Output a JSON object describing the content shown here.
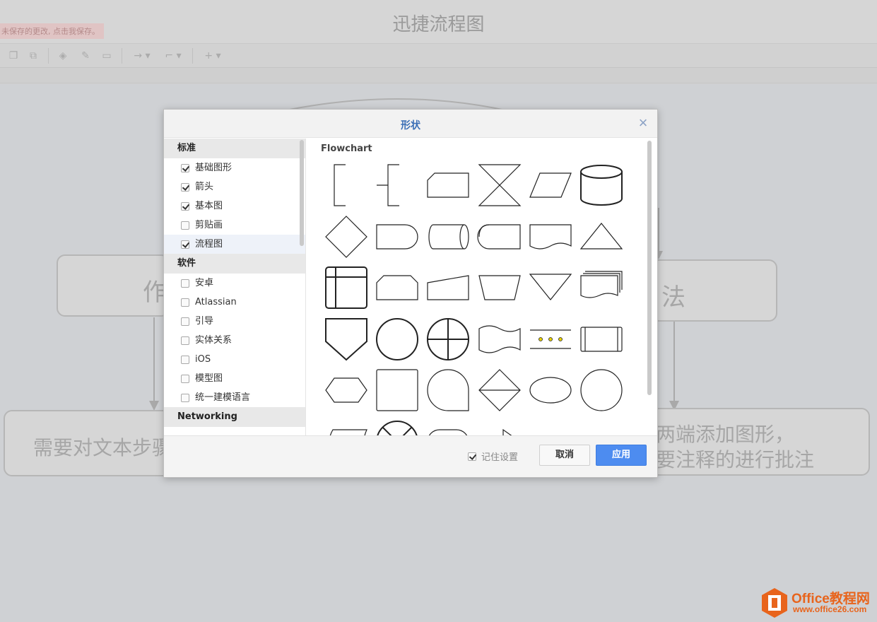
{
  "app": {
    "title": "迅捷流程图",
    "unsaved_notice": "未保存的更改, 点击我保存。"
  },
  "toolbar": {
    "icons": [
      "copy-icon",
      "duplicate-icon",
      "fill-color-icon",
      "line-color-icon",
      "shadow-icon",
      "connector-straight-icon",
      "connector-elbow-icon",
      "add-icon"
    ]
  },
  "canvas": {
    "box_left_text": "作",
    "box_right_text": "法",
    "bottom_left_text": "需要对文本步骤",
    "bottom_right_line1": "两端添加图形，",
    "bottom_right_line2": "要注释的进行批注"
  },
  "dialog": {
    "title": "形状",
    "close_icon": "close-icon",
    "sidebar": {
      "groups": [
        {
          "label": "标准",
          "items": [
            {
              "label": "基础图形",
              "checked": true
            },
            {
              "label": "箭头",
              "checked": true
            },
            {
              "label": "基本图",
              "checked": true
            },
            {
              "label": "剪贴画",
              "checked": false
            },
            {
              "label": "流程图",
              "checked": true
            }
          ]
        },
        {
          "label": "软件",
          "items": [
            {
              "label": "安卓",
              "checked": false
            },
            {
              "label": "Atlassian",
              "checked": false
            },
            {
              "label": "引导",
              "checked": false
            },
            {
              "label": "实体关系",
              "checked": false
            },
            {
              "label": "iOS",
              "checked": false
            },
            {
              "label": "模型图",
              "checked": false
            },
            {
              "label": "统一建模语言",
              "checked": false
            }
          ]
        },
        {
          "label": "Networking",
          "items": []
        }
      ]
    },
    "main": {
      "section_title": "Flowchart",
      "shapes": [
        "annotation-1",
        "annotation-2",
        "card",
        "collate",
        "data",
        "database",
        "decision",
        "delay",
        "direct-data",
        "display",
        "document",
        "extract",
        "internal-storage",
        "loop-limit",
        "manual-input",
        "manual-operation",
        "merge",
        "multi-document",
        "off-page-reference",
        "on-page-reference",
        "or",
        "paper-tape",
        "parallel-mode",
        "predefined-process",
        "preparation",
        "process",
        "sequential-data",
        "sort",
        "start",
        "start-2",
        "stored-data",
        "summing-junction",
        "terminator",
        "transfer"
      ]
    },
    "footer": {
      "remember_label": "记住设置",
      "remember_checked": true,
      "cancel_label": "取消",
      "apply_label": "应用"
    }
  },
  "watermark": {
    "brand": "Office教程网",
    "url": "www.office26.com"
  },
  "colors": {
    "accent": "#4d8cf0",
    "title_blue": "#3b6fb6",
    "watermark_orange": "#e8641c"
  }
}
